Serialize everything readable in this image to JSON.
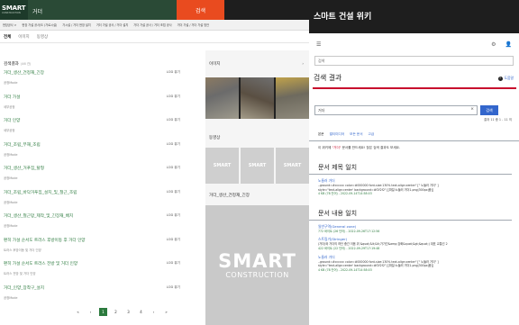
{
  "portal": {
    "logo_main": "SMART",
    "logo_sub": "CONSTRUCTION",
    "search_value": "거더",
    "search_button": "검색",
    "subnav": [
      "현장공사 >",
      "현장 가설 공사/도 (가로시설)",
      "가시설 / 거더 현장 설치",
      "거더 가설 공사 / 거더 설치",
      "거더 가설 공사 / 거더 조립 공사",
      "거더 가설 / 거더 가설 방안"
    ],
    "tabs": [
      "전체",
      "이미지",
      "동영상"
    ],
    "results_heading": "검색결과",
    "results_count": "(46 건)",
    "results": [
      {
        "title": "거더_생산_건정재_긴장",
        "meta": "공정Mode",
        "size": "LOD 뷰기"
      },
      {
        "title": "거더 가설",
        "meta": "세부공정",
        "size": "LOD 뷰기"
      },
      {
        "title": "거더 인양",
        "meta": "세부공정",
        "size": "LOD 뷰기"
      },
      {
        "title": "거더_조립_부재_조립",
        "meta": "공정Mode",
        "size": "LOD 뷰기"
      },
      {
        "title": "거더_생산_거푸집_탈형",
        "meta": "공정Mode",
        "size": "LOD 뷰기"
      },
      {
        "title": "거더_조립_바닥거푸집_설치_및_철근_조립",
        "meta": "공정Mode",
        "size": "LOD 뷰기"
      },
      {
        "title": "거더_생산_철근망_제작_및_긴장재_배치",
        "meta": "공정Mode",
        "size": "LOD 뷰기"
      },
      {
        "title": "편히 가설 순서도 트러스 후방이동 후 거더 인양",
        "meta": "트러스 후방이동 및 거더 인양",
        "size": "LOD 뷰기"
      },
      {
        "title": "편히 가설 순서도 트러스 전방 및 거더 인양",
        "meta": "트러스 전방 및 거더 인양",
        "size": "LOD 뷰기"
      },
      {
        "title": "거더_인양_장착구_설치",
        "meta": "공정Mode",
        "size": "LOD 뷰기"
      }
    ],
    "pages": [
      "1",
      "2",
      "3",
      "4"
    ],
    "page_prev": "‹",
    "page_first": "«",
    "page_next": "›",
    "page_last": "»",
    "side_image_title": "이미지",
    "side_video_title": "동영상",
    "side_more": "›",
    "video_thumb_label": "SMART",
    "video_caption": "거더_생산_건정재_긴장",
    "big_logo": "SMART",
    "big_sub": "CONSTRUCTION"
  },
  "wiki": {
    "title": "스마트 건설 위키",
    "search_placeholder": "검색",
    "page_title": "검색 결과",
    "help_label": "도움말",
    "query": "거더",
    "go_label": "검색",
    "result_count": "결과 11 중 1 - 11 의",
    "tabs": [
      "본문",
      "멀티미디어",
      "모든 문서",
      "고급"
    ],
    "notice_pre": "이 위키에 ",
    "notice_term": "\"거더\"",
    "notice_post": " 문서를 만드세요! 찾은 검색 결과도 보세요.",
    "section_title": "문서 제목 일치",
    "title_hits": [
      {
        "title": "노들러 거더",
        "snippet": "..ground=#cccccc color=#000000 font-size:130% text-align:center\" [\" 노들러 거더\" ]",
        "snippet2": "style=\"text-align:center' background=#f2f2f2\" [[파일:노들러 거더1.png|300px|중]]",
        "meta": "4 KB (78 단어) - 2022-09-14T14:58:03"
      }
    ],
    "section_content": "문서 내용 일치",
    "content_hits": [
      {
        "title": "일반구역(General zone)",
        "snippet": "",
        "snippet2": "",
        "meta": "772 바이트 (26 단어) - 2022-09-26T17:12:56"
      },
      {
        "title": "스트링거(Stringer)",
        "snippet": "(거더)와 거더의 하단 중간 이음 위 &quot;&lt;&lt;가가간&amp;강화&quot;&gt;&quot;) 대표 교통선 2",
        "snippet2": "",
        "meta": "422 바이트 (22 단어) - 2022-09-29T17:19:48"
      },
      {
        "title": "노들러 거더",
        "snippet": "..ground=#cccccc color=#000000 font-size:130% text-align:center\" [\" 노들러 거더\" ]",
        "snippet2": "style=\"text-align:center' background=#f2f2f2\" [[파일:노들러 거더1.png|300px|중]]",
        "meta": "4 KB (78 단어) - 2022-09-14T14:58:03"
      }
    ]
  }
}
